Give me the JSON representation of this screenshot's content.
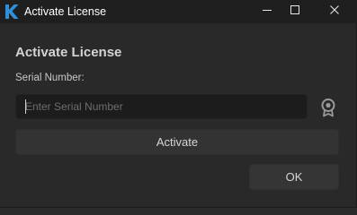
{
  "window": {
    "title": "Activate License",
    "icon": "k-logo-icon",
    "controls": [
      "minimize-icon",
      "maximize-icon",
      "close-icon"
    ]
  },
  "dialog": {
    "heading": "Activate License",
    "serial_label": "Serial Number:",
    "serial_value": "",
    "serial_placeholder": "Enter Serial Number",
    "badge_icon": "award-badge-icon",
    "activate_label": "Activate",
    "ok_label": "OK"
  },
  "colors": {
    "background": "#292929",
    "titlebar": "#1f1f1f",
    "input_background": "#1c1c1c",
    "button_background": "#333333",
    "logo_accent": "#2f8fd8"
  }
}
